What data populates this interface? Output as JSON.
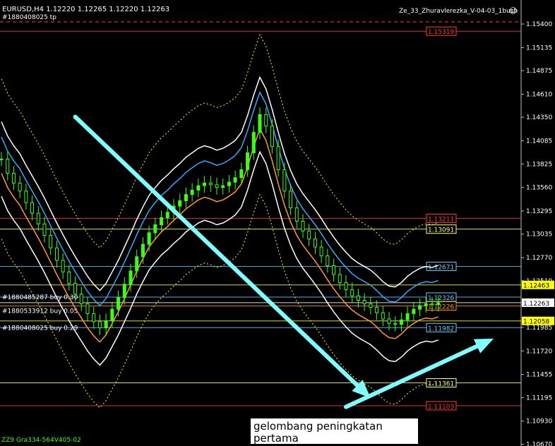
{
  "header": {
    "symbol_info": "EURUSD,H4  1.12220 1.12265 1.12220 1.12263",
    "order_line": "#1880408025 tp",
    "indicator_name": "Ze_33_Zhuravlerezka_V-04-03_1bush"
  },
  "caption": "gelombang peningkatan pertama",
  "bottom_left_label": "ZZ9 Gra334-564V405-02",
  "chart_data": {
    "type": "candlestick",
    "symbol": "EURUSD",
    "timeframe": "H4",
    "ohlc": {
      "open": 1.1222,
      "high": 1.12265,
      "low": 1.1222,
      "close": 1.12263
    },
    "ylim": [
      1.1065,
      1.1567
    ],
    "y_ticks": [
      "1.15400",
      "1.15135",
      "1.14875",
      "1.14610",
      "1.14350",
      "1.14085",
      "1.13825",
      "1.13560",
      "1.13295",
      "1.13035",
      "1.12770",
      "1.12510",
      "1.12245",
      "1.11985",
      "1.11720",
      "1.11455",
      "1.11195",
      "1.10930",
      "1.10670"
    ],
    "closes": [
      1.1388,
      1.1372,
      1.1361,
      1.1352,
      1.1339,
      1.1327,
      1.1315,
      1.1302,
      1.1288,
      1.1274,
      1.1261,
      1.1248,
      1.1236,
      1.1225,
      1.1214,
      1.1205,
      1.1198,
      1.1206,
      1.1219,
      1.1232,
      1.1247,
      1.1262,
      1.1278,
      1.1292,
      1.1305,
      1.1314,
      1.1322,
      1.1328,
      1.1335,
      1.1341,
      1.1348,
      1.1353,
      1.1358,
      1.1361,
      1.1359,
      1.1356,
      1.1358,
      1.1362,
      1.1367,
      1.1376,
      1.1395,
      1.1418,
      1.1438,
      1.1425,
      1.1402,
      1.1376,
      1.1352,
      1.1333,
      1.1318,
      1.1307,
      1.1298,
      1.1289,
      1.1279,
      1.1268,
      1.1258,
      1.1249,
      1.1241,
      1.1234,
      1.1229,
      1.1225,
      1.1221,
      1.1215,
      1.1208,
      1.1203,
      1.1202,
      1.1207,
      1.1214,
      1.1219,
      1.1223,
      1.1225,
      1.1224,
      1.12263
    ],
    "price_labels": [
      {
        "value": 1.15319,
        "label": "1.15319",
        "color": "#ff3b30",
        "box": false
      },
      {
        "value": 1.13211,
        "label": "1.13211",
        "color": "#ff3b30",
        "box": false
      },
      {
        "value": 1.13091,
        "label": "1.13091",
        "color": "#ffff66",
        "box": false
      },
      {
        "value": 1.12671,
        "label": "1.12671",
        "color": "#66ccff",
        "box": false
      },
      {
        "value": 1.12463,
        "label": "1.12463",
        "color": "#ffff00",
        "box": true
      },
      {
        "value": 1.12326,
        "label": "1.12326",
        "color": "#66ccff",
        "box": false
      },
      {
        "value": 1.12263,
        "label": "1.12263",
        "color": "#ffffff",
        "box": true
      },
      {
        "value": 1.12226,
        "label": "1.12226",
        "color": "#ff9900",
        "box": false
      },
      {
        "value": 1.12058,
        "label": "1.12058",
        "color": "#ffff00",
        "box": true
      },
      {
        "value": 1.11982,
        "label": "1.11982",
        "color": "#66ccff",
        "box": false
      },
      {
        "value": 1.11361,
        "label": "1.11361",
        "color": "#ffff66",
        "box": false
      },
      {
        "value": 1.11103,
        "label": "1.11103",
        "color": "#ff3b30",
        "box": false
      }
    ],
    "order_labels": [
      {
        "value": 1.12326,
        "label": "#1880485287 buy 0.30"
      },
      {
        "value": 1.1217,
        "label": "#1880533912 buy 0.05"
      },
      {
        "value": 1.11982,
        "label": "#1880408025 buy 0.29"
      }
    ],
    "arrows": [
      {
        "from": [
          12,
          1.14355
        ],
        "to": [
          60,
          1.1119
        ],
        "color": "#7fffff"
      },
      {
        "from": [
          56,
          1.1109
        ],
        "to": [
          80,
          1.1186
        ],
        "color": "#7fffff"
      }
    ],
    "grid": false
  }
}
